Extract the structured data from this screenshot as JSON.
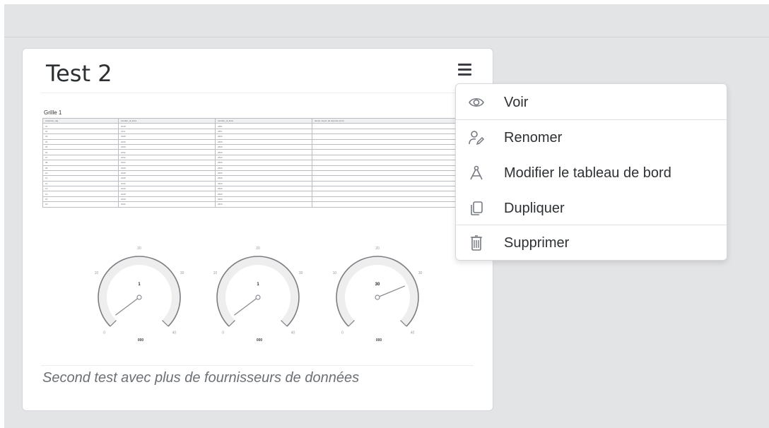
{
  "dashboard": {
    "title": "Test 2",
    "description": "Second test avec plus de fournisseurs de données",
    "grid": {
      "title": "Grille 1",
      "columns": [
        "customer_tag",
        "number_of_lines",
        "number_of_lines",
        "temps moyen de réponse (min)"
      ],
      "rows": [
        [
          "01",
          "2018",
          "2851",
          ""
        ],
        [
          "02",
          "2111",
          "2857",
          ""
        ],
        [
          "03",
          "2008",
          "2826",
          ""
        ],
        [
          "04",
          "2029",
          "2829",
          ""
        ],
        [
          "05",
          "2029",
          "2829",
          ""
        ],
        [
          "06",
          "2032",
          "2823",
          ""
        ],
        [
          "07",
          "2022",
          "2823",
          ""
        ],
        [
          "08",
          "2022",
          "2829",
          ""
        ],
        [
          "09",
          "2029",
          "2829",
          ""
        ],
        [
          "10",
          "2028",
          "2826",
          ""
        ],
        [
          "11",
          "2028",
          "2826",
          ""
        ],
        [
          "12",
          "2032",
          "2823",
          ""
        ],
        [
          "13",
          "2029",
          "2829",
          ""
        ],
        [
          "14",
          "2028",
          "2826",
          ""
        ],
        [
          "15",
          "2029",
          "2829",
          ""
        ],
        [
          "16",
          "2032",
          "2823",
          ""
        ]
      ]
    },
    "gauges": [
      {
        "value_label": "1",
        "bottom_label": "000",
        "ticks": [
          "0",
          "10",
          "20",
          "30",
          "40"
        ],
        "value_fraction": 0.03
      },
      {
        "value_label": "1",
        "bottom_label": "000",
        "ticks": [
          "0",
          "10",
          "20",
          "30",
          "40"
        ],
        "value_fraction": 0.03
      },
      {
        "value_label": "30",
        "bottom_label": "000",
        "ticks": [
          "0",
          "10",
          "20",
          "30",
          "40"
        ],
        "value_fraction": 0.75
      }
    ]
  },
  "menu": {
    "icon": "hamburger-icon",
    "items": [
      {
        "label": "Voir",
        "icon": "eye-icon"
      },
      {
        "label": "Renomer",
        "icon": "user-edit-icon"
      },
      {
        "label": "Modifier le tableau de bord",
        "icon": "compass-icon"
      },
      {
        "label": "Dupliquer",
        "icon": "copy-icon"
      },
      {
        "label": "Supprimer",
        "icon": "trash-icon"
      }
    ]
  }
}
